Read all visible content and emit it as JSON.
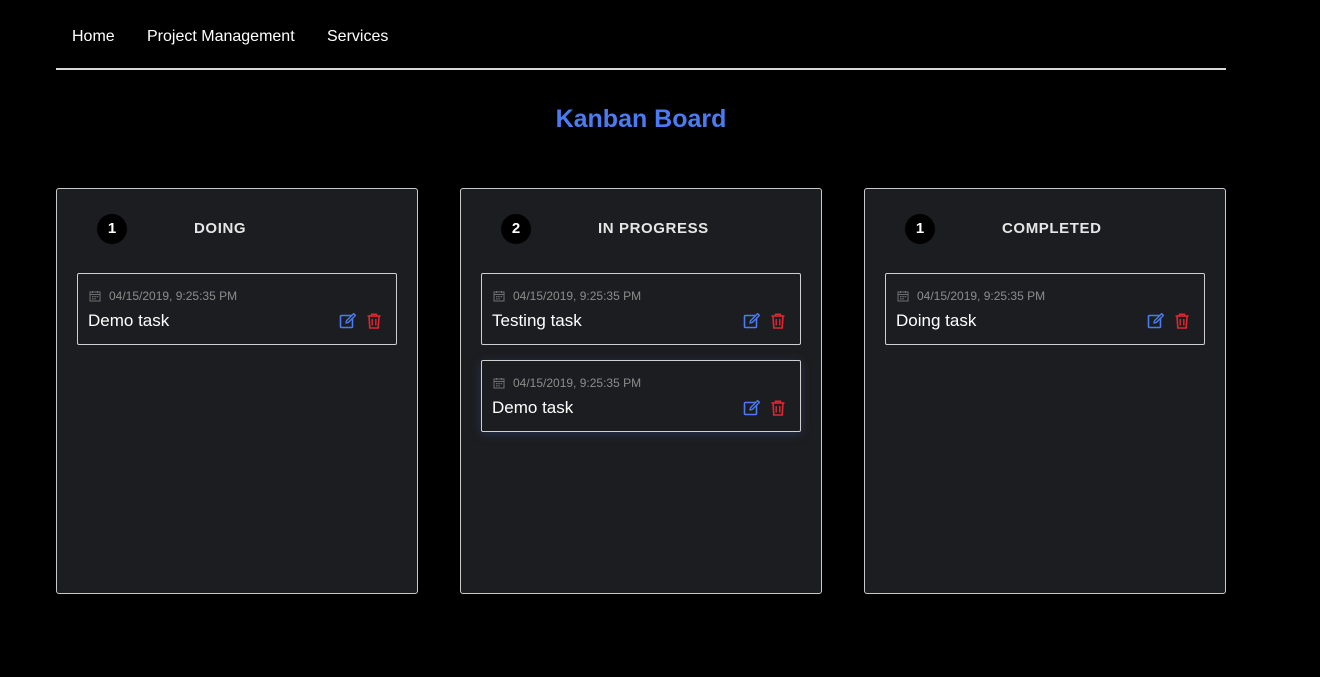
{
  "nav": {
    "links": [
      "Home",
      "Project Management",
      "Services"
    ]
  },
  "page": {
    "title": "Kanban Board"
  },
  "colors": {
    "accent": "#4a7bf2",
    "delete": "#e0262f",
    "column_bg": "#1c1d20"
  },
  "columns": [
    {
      "title": "DOING",
      "count": "1",
      "cards": [
        {
          "date": "04/15/2019, 9:25:35 PM",
          "title": "Demo task",
          "icons": [
            "calendar-icon",
            "edit-icon",
            "trash-icon"
          ]
        }
      ]
    },
    {
      "title": "IN PROGRESS",
      "count": "2",
      "cards": [
        {
          "date": "04/15/2019, 9:25:35 PM",
          "title": "Testing task",
          "icons": [
            "calendar-icon",
            "edit-icon",
            "trash-icon"
          ]
        },
        {
          "date": "04/15/2019, 9:25:35 PM",
          "title": "Demo task",
          "icons": [
            "calendar-icon",
            "edit-icon",
            "trash-icon"
          ]
        }
      ]
    },
    {
      "title": "COMPLETED",
      "count": "1",
      "cards": [
        {
          "date": "04/15/2019, 9:25:35 PM",
          "title": "Doing task",
          "icons": [
            "calendar-icon",
            "edit-icon",
            "trash-icon"
          ]
        }
      ]
    }
  ]
}
